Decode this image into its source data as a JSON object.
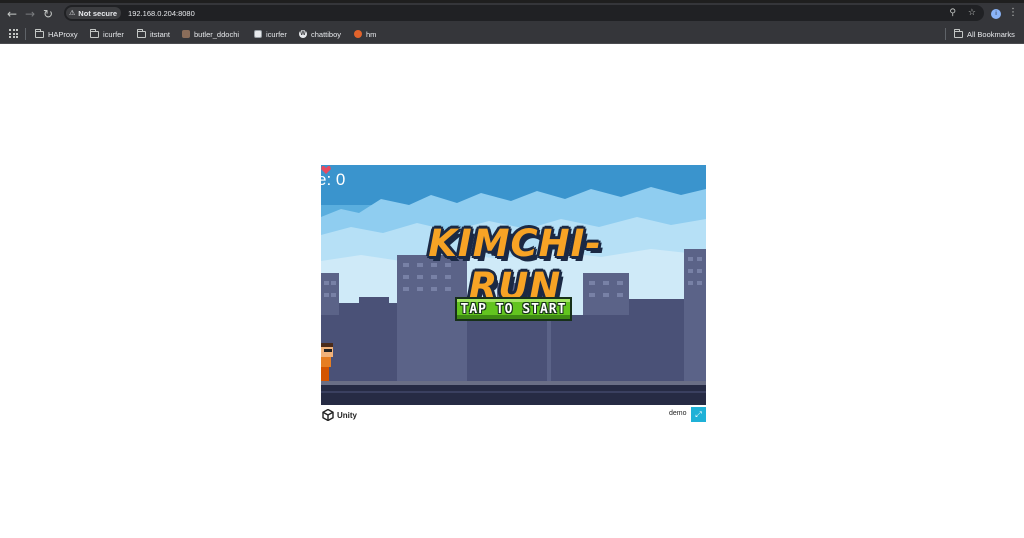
{
  "browser": {
    "security_label": "Not secure",
    "url": "192.168.0.204:8080",
    "bookmarks": [
      {
        "label": "HAProxy",
        "icon": "folder-icon"
      },
      {
        "label": "icurfer",
        "icon": "folder-icon"
      },
      {
        "label": "itstant",
        "icon": "folder-icon"
      },
      {
        "label": "butler_ddochi",
        "icon": "site-favicon"
      },
      {
        "label": "icurfer",
        "icon": "site-favicon"
      },
      {
        "label": "chattiboy",
        "icon": "wordpress-icon"
      },
      {
        "label": "hm",
        "icon": "gitlab-icon"
      }
    ],
    "all_bookmarks_label": "All Bookmarks",
    "profile_initial": "i",
    "colors": {
      "chrome": "#35363a",
      "omnibox": "#202124"
    }
  },
  "game": {
    "score_text": "e: 0",
    "logo_text": "KIMCHI-RUN",
    "start_label": "TAP TO START",
    "colors": {
      "sky": "#3a94cd",
      "logo": "#f7a325",
      "button": "#62c41f"
    }
  },
  "unity_footer": {
    "logo_text": "Unity",
    "build_title": "demo",
    "fullscreen_icon": "expand-icon"
  }
}
